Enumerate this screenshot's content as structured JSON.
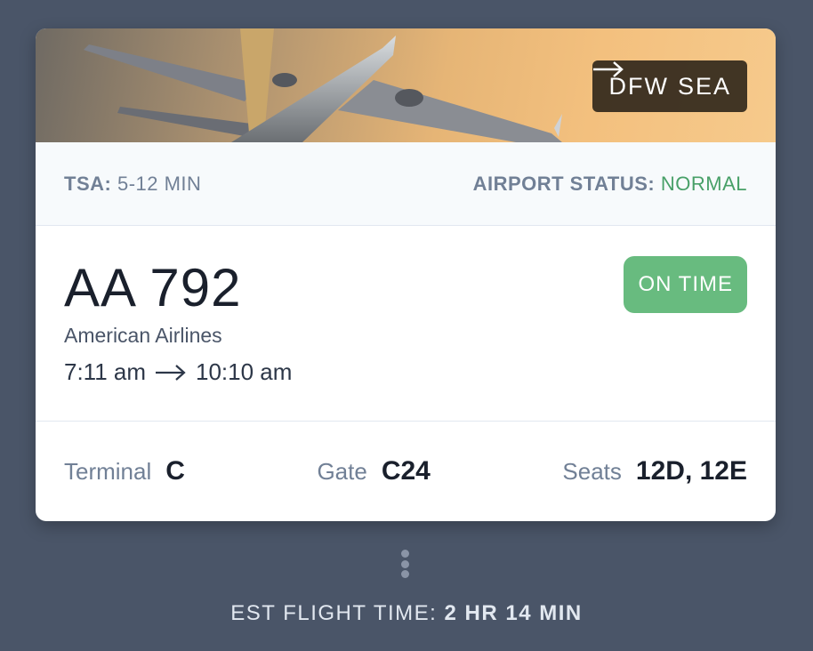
{
  "route": {
    "from": "DFW",
    "to": "SEA"
  },
  "status_bar": {
    "tsa_label": "TSA:",
    "tsa_value": "5-12 MIN",
    "airport_status_label": "AIRPORT STATUS:",
    "airport_status_value": "NORMAL"
  },
  "flight": {
    "number": "AA 792",
    "airline": "American Airlines",
    "departure": "7:11 am",
    "arrival": "10:10 am",
    "status": "ON TIME"
  },
  "details": {
    "terminal_label": "Terminal",
    "terminal_value": "C",
    "gate_label": "Gate",
    "gate_value": "C24",
    "seats_label": "Seats",
    "seats_value": "12D, 12E"
  },
  "footer": {
    "est_label": "EST FLIGHT TIME:",
    "est_value": "2 HR 14 MIN"
  },
  "colors": {
    "background": "#4a5568",
    "status_normal": "#48a068",
    "on_time_badge": "#68bb7f"
  },
  "icons": {
    "hero": "airplane-photo",
    "arrow": "right-arrow-icon",
    "more": "vertical-dots-icon"
  }
}
